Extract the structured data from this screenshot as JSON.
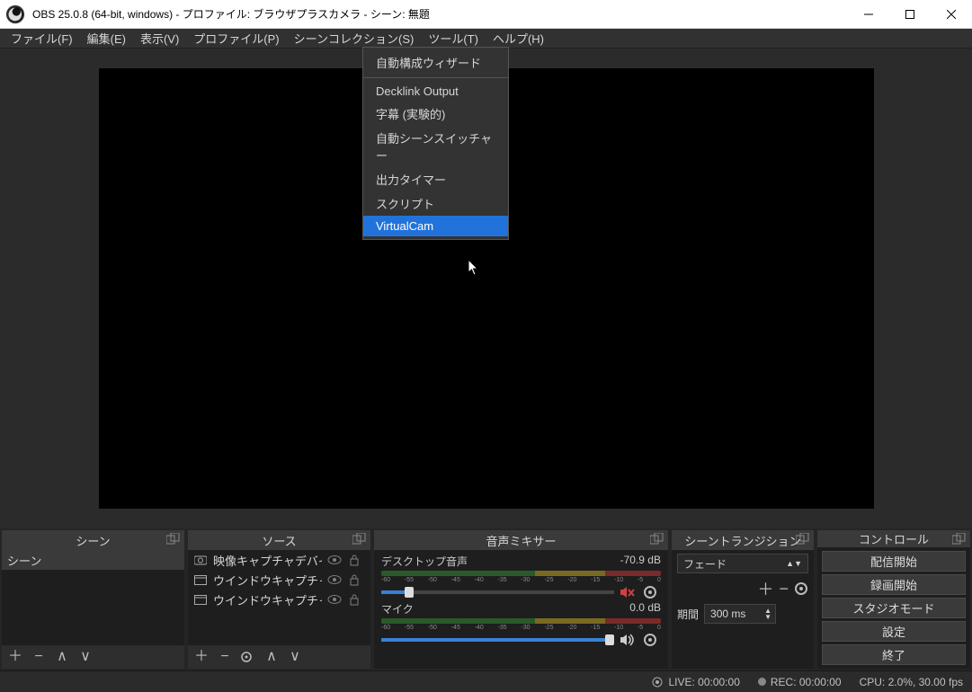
{
  "titlebar": {
    "title": "OBS 25.0.8 (64-bit, windows) - プロファイル: ブラウザプラスカメラ - シーン: 無題"
  },
  "menubar": {
    "items": [
      "ファイル(F)",
      "編集(E)",
      "表示(V)",
      "プロファイル(P)",
      "シーンコレクション(S)",
      "ツール(T)",
      "ヘルプ(H)"
    ]
  },
  "dropdown": {
    "items": [
      {
        "label": "自動構成ウィザード"
      },
      {
        "sep": true
      },
      {
        "label": "Decklink Output"
      },
      {
        "label": "字幕 (実験的)"
      },
      {
        "label": "自動シーンスイッチャー"
      },
      {
        "label": "出力タイマー"
      },
      {
        "label": "スクリプト"
      },
      {
        "label": "VirtualCam",
        "highlighted": true
      }
    ]
  },
  "docks": {
    "scenes": {
      "title": "シーン",
      "items": [
        "シーン"
      ]
    },
    "sources": {
      "title": "ソース",
      "items": [
        {
          "icon": "camera",
          "label": "映像キャプチャデバイス"
        },
        {
          "icon": "window",
          "label": "ウインドウキャプチャ_re"
        },
        {
          "icon": "window",
          "label": "ウインドウキャプチャ_ch"
        }
      ]
    },
    "mixer": {
      "title": "音声ミキサー",
      "channels": [
        {
          "name": "デスクトップ音声",
          "db": "-70.9 dB",
          "muted": true,
          "fill_pct": 12
        },
        {
          "name": "マイク",
          "db": "0.0 dB",
          "muted": false,
          "fill_pct": 100
        }
      ],
      "scale_labels": [
        "-60",
        "-55",
        "-50",
        "-45",
        "-40",
        "-35",
        "-30",
        "-25",
        "-20",
        "-15",
        "-10",
        "-5",
        "0"
      ]
    },
    "transitions": {
      "title": "シーントランジション",
      "selected": "フェード",
      "duration_label": "期間",
      "duration_value": "300 ms"
    },
    "controls": {
      "title": "コントロール",
      "buttons": [
        "配信開始",
        "録画開始",
        "スタジオモード",
        "設定",
        "終了"
      ]
    }
  },
  "statusbar": {
    "live": "LIVE: 00:00:00",
    "rec": "REC: 00:00:00",
    "cpu": "CPU: 2.0%, 30.00 fps"
  }
}
